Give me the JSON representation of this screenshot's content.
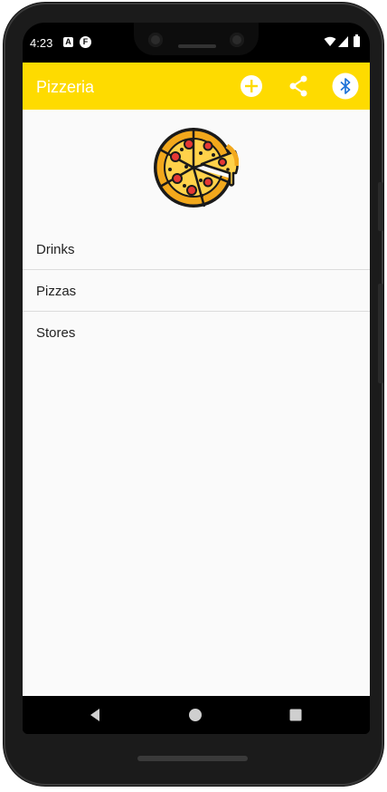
{
  "status_bar": {
    "time": "4:23",
    "icons": [
      "a-notification-icon",
      "f-notification-icon",
      "wifi-icon",
      "signal-icon",
      "battery-icon"
    ]
  },
  "app_bar": {
    "title": "Pizzeria",
    "actions": [
      "add-icon",
      "share-icon",
      "bluetooth-icon"
    ],
    "background_color": "#fedb00"
  },
  "logo": {
    "icon": "pizza-icon"
  },
  "menu": {
    "items": [
      {
        "label": "Drinks"
      },
      {
        "label": "Pizzas"
      },
      {
        "label": "Stores"
      }
    ]
  },
  "nav_bar": {
    "buttons": [
      "back-icon",
      "home-icon",
      "recents-icon"
    ]
  }
}
